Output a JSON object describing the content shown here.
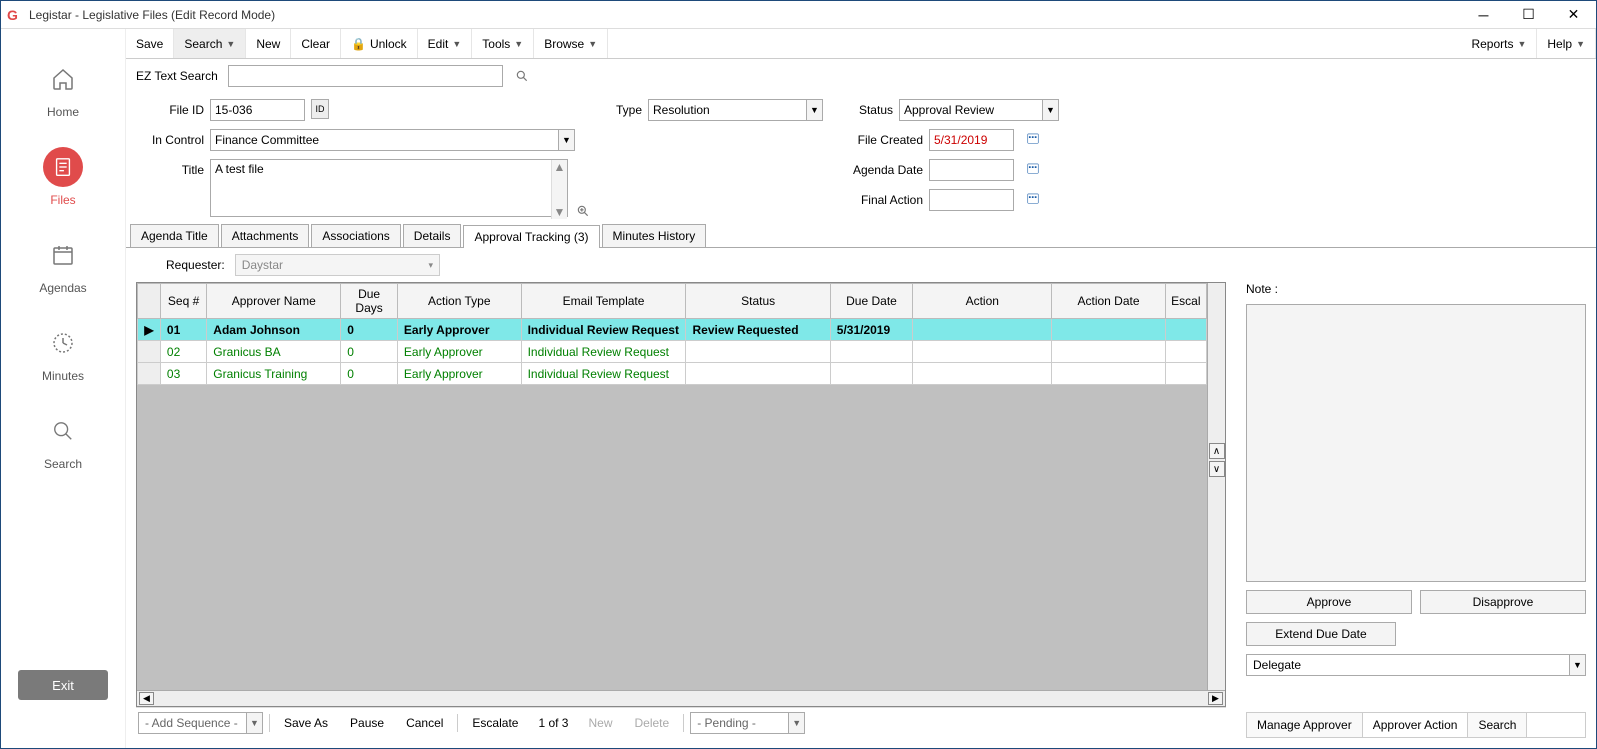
{
  "window": {
    "title": "Legistar - Legislative Files (Edit Record Mode)"
  },
  "toolbar": {
    "save": "Save",
    "search": "Search",
    "new": "New",
    "clear": "Clear",
    "unlock": "Unlock",
    "edit": "Edit",
    "tools": "Tools",
    "browse": "Browse",
    "reports": "Reports",
    "help": "Help"
  },
  "sidebar": {
    "home": "Home",
    "files": "Files",
    "agendas": "Agendas",
    "minutes": "Minutes",
    "search": "Search",
    "exit": "Exit"
  },
  "ez": {
    "label": "EZ Text Search"
  },
  "form": {
    "file_id_label": "File ID",
    "file_id": "15-036",
    "id_btn": "ID",
    "type_label": "Type",
    "type": "Resolution",
    "status_label": "Status",
    "status": "Approval Review",
    "in_control_label": "In Control",
    "in_control": "Finance Committee",
    "file_created_label": "File Created",
    "file_created": "5/31/2019",
    "title_label": "Title",
    "title": "A test file",
    "agenda_date_label": "Agenda Date",
    "agenda_date": "",
    "final_action_label": "Final Action",
    "final_action": ""
  },
  "tabs": {
    "agenda_title": "Agenda Title",
    "attachments": "Attachments",
    "associations": "Associations",
    "details": "Details",
    "approval_tracking": "Approval Tracking (3)",
    "minutes_history": "Minutes History"
  },
  "requester": {
    "label": "Requester:",
    "value": "Daystar"
  },
  "grid": {
    "headers": {
      "seq": "Seq #",
      "approver": "Approver Name",
      "due_days": "Due Days",
      "action_type": "Action Type",
      "email_template": "Email Template",
      "status": "Status",
      "due_date": "Due Date",
      "action": "Action",
      "action_date": "Action Date",
      "escal": "Escal"
    },
    "rows": [
      {
        "seq": "01",
        "approver": "Adam Johnson",
        "due_days": "0",
        "action_type": "Early Approver",
        "email_template": "Individual Review Request",
        "status": "Review Requested",
        "due_date": "5/31/2019",
        "action": "",
        "action_date": "",
        "selected": true
      },
      {
        "seq": "02",
        "approver": "Granicus BA",
        "due_days": "0",
        "action_type": "Early Approver",
        "email_template": "Individual Review Request",
        "status": "",
        "due_date": "",
        "action": "",
        "action_date": "",
        "selected": false
      },
      {
        "seq": "03",
        "approver": "Granicus Training",
        "due_days": "0",
        "action_type": "Early Approver",
        "email_template": "Individual Review Request",
        "status": "",
        "due_date": "",
        "action": "",
        "action_date": "",
        "selected": false
      }
    ]
  },
  "side_panel": {
    "note_label": "Note :",
    "approve": "Approve",
    "disapprove": "Disapprove",
    "extend": "Extend Due Date",
    "delegate": "Delegate",
    "tabs": {
      "manage": "Manage Approver",
      "action": "Approver Action",
      "search": "Search"
    }
  },
  "bottom": {
    "add_sequence": "- Add Sequence -",
    "save_as": "Save As",
    "pause": "Pause",
    "cancel": "Cancel",
    "escalate": "Escalate",
    "paging": "1 of 3",
    "new": "New",
    "delete": "Delete",
    "pending": "- Pending -"
  }
}
